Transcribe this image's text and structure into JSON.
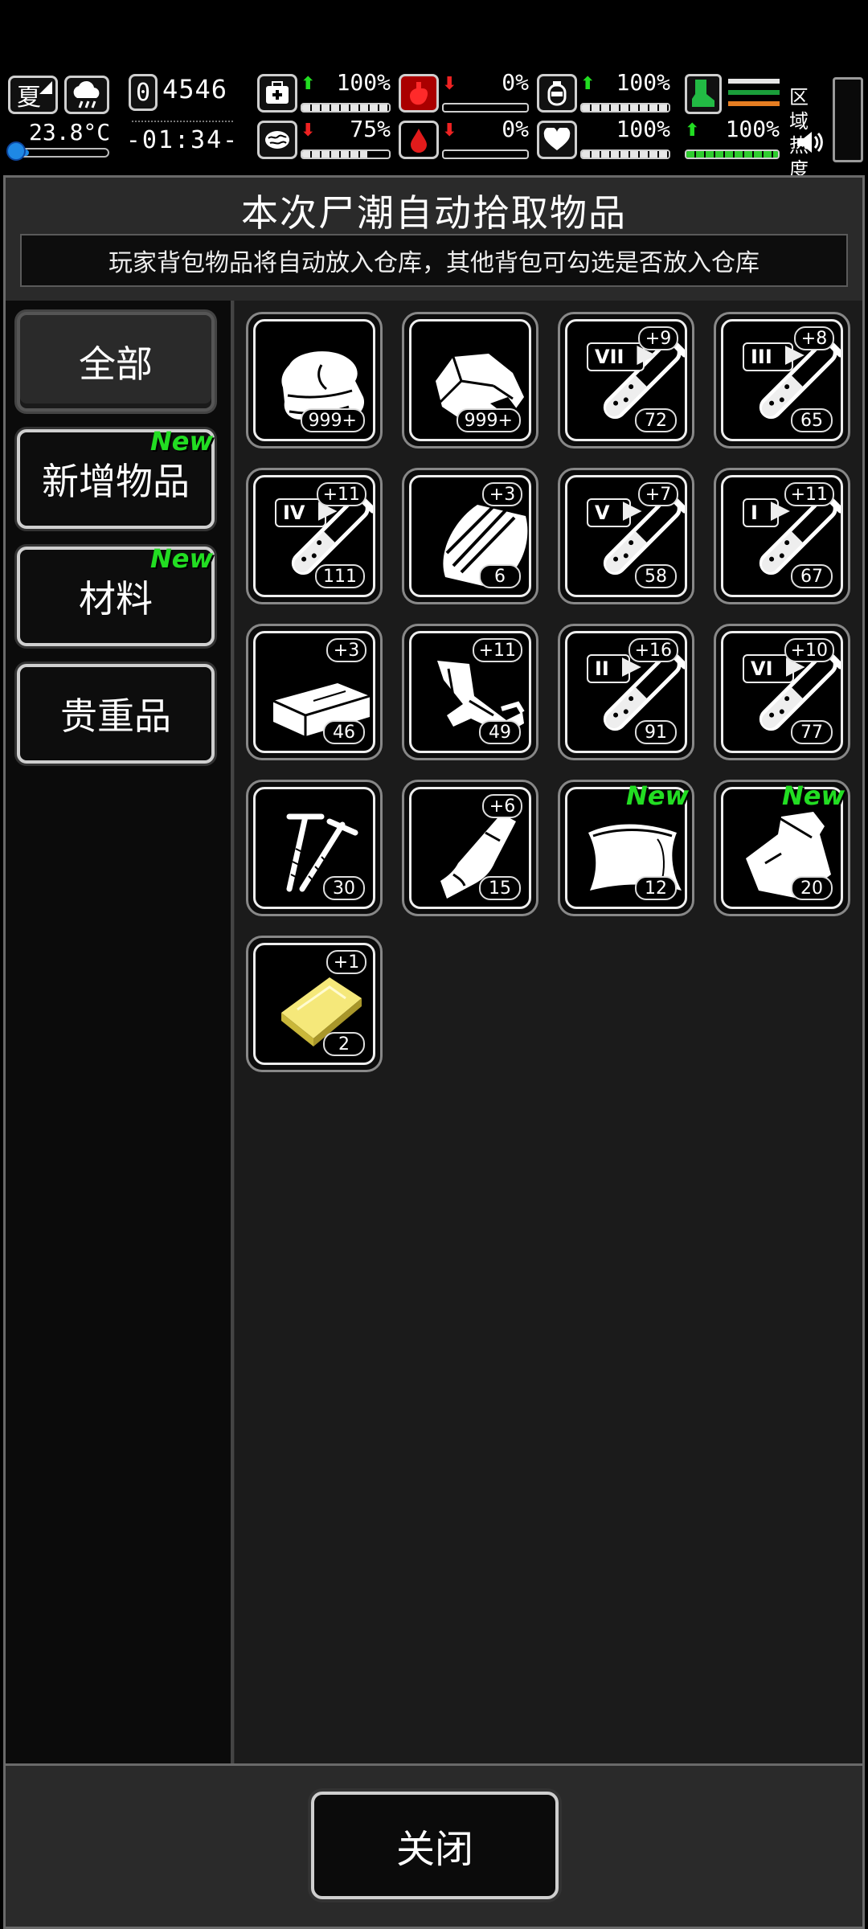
{
  "hud": {
    "season": "夏",
    "temperature": "23.8°C",
    "temperature_level": 0.2,
    "day": "0",
    "day_count": "4546",
    "clock": "-01:34-",
    "stats": [
      {
        "name": "health",
        "value": "100%",
        "trend": "up",
        "level": 1.0
      },
      {
        "name": "hunger",
        "value": "0%",
        "trend": "down",
        "level": 0.0
      },
      {
        "name": "thirst",
        "value": "100%",
        "trend": "up",
        "level": 1.0
      },
      {
        "name": "sanity",
        "value": "75%",
        "trend": "down",
        "level": 0.75
      },
      {
        "name": "bleeding",
        "value": "0%",
        "trend": "down",
        "level": 0.0
      },
      {
        "name": "heart",
        "value": "100%",
        "trend": "none",
        "level": 1.0
      }
    ],
    "stamina": {
      "value": "100%",
      "trend": "up",
      "level": 1.0
    },
    "region_heat_label": "区域热度",
    "colors": {
      "up": "#22dd22",
      "down": "#e22222",
      "temp": "#1e88e5",
      "stamina_lines": [
        "#e6e6e6",
        "#1a9e3a",
        "#e67e22"
      ]
    }
  },
  "panel": {
    "title": "本次尸潮自动拾取物品",
    "subtitle": "玩家背包物品将自动放入仓库，其他背包可勾选是否放入仓库"
  },
  "categories": [
    {
      "label": "全部",
      "new": false,
      "active": true
    },
    {
      "label": "新增物品",
      "new": true,
      "active": false
    },
    {
      "label": "材料",
      "new": true,
      "active": false
    },
    {
      "label": "贵重品",
      "new": false,
      "active": false
    }
  ],
  "new_label": "New",
  "items": [
    {
      "icon": "cloth-icon",
      "count": "999+",
      "bonus": "",
      "tier": "",
      "new": false
    },
    {
      "icon": "rock-icon",
      "count": "999+",
      "bonus": "",
      "tier": "",
      "new": false
    },
    {
      "icon": "test-tube-icon",
      "count": "72",
      "bonus": "+9",
      "tier": "VII",
      "new": false
    },
    {
      "icon": "test-tube-icon",
      "count": "65",
      "bonus": "+8",
      "tier": "III",
      "new": false
    },
    {
      "icon": "test-tube-icon",
      "count": "111",
      "bonus": "+11",
      "tier": "IV",
      "new": false
    },
    {
      "icon": "wood-planks-icon",
      "count": "6",
      "bonus": "+3",
      "tier": "",
      "new": false
    },
    {
      "icon": "test-tube-icon",
      "count": "58",
      "bonus": "+7",
      "tier": "V",
      "new": false
    },
    {
      "icon": "test-tube-icon",
      "count": "67",
      "bonus": "+11",
      "tier": "I",
      "new": false
    },
    {
      "icon": "brick-icon",
      "count": "46",
      "bonus": "+3",
      "tier": "",
      "new": false
    },
    {
      "icon": "scrap-metal-icon",
      "count": "49",
      "bonus": "+11",
      "tier": "",
      "new": false
    },
    {
      "icon": "test-tube-icon",
      "count": "91",
      "bonus": "+16",
      "tier": "II",
      "new": false
    },
    {
      "icon": "test-tube-icon",
      "count": "77",
      "bonus": "+10",
      "tier": "VI",
      "new": false
    },
    {
      "icon": "screws-icon",
      "count": "30",
      "bonus": "",
      "tier": "",
      "new": false
    },
    {
      "icon": "leather-icon",
      "count": "15",
      "bonus": "+6",
      "tier": "",
      "new": false
    },
    {
      "icon": "plastic-sheet-icon",
      "count": "12",
      "bonus": "",
      "tier": "",
      "new": true
    },
    {
      "icon": "pouch-icon",
      "count": "20",
      "bonus": "",
      "tier": "",
      "new": true
    },
    {
      "icon": "gold-bar-icon",
      "count": "2",
      "bonus": "+1",
      "tier": "",
      "new": false
    }
  ],
  "close_label": "关闭"
}
